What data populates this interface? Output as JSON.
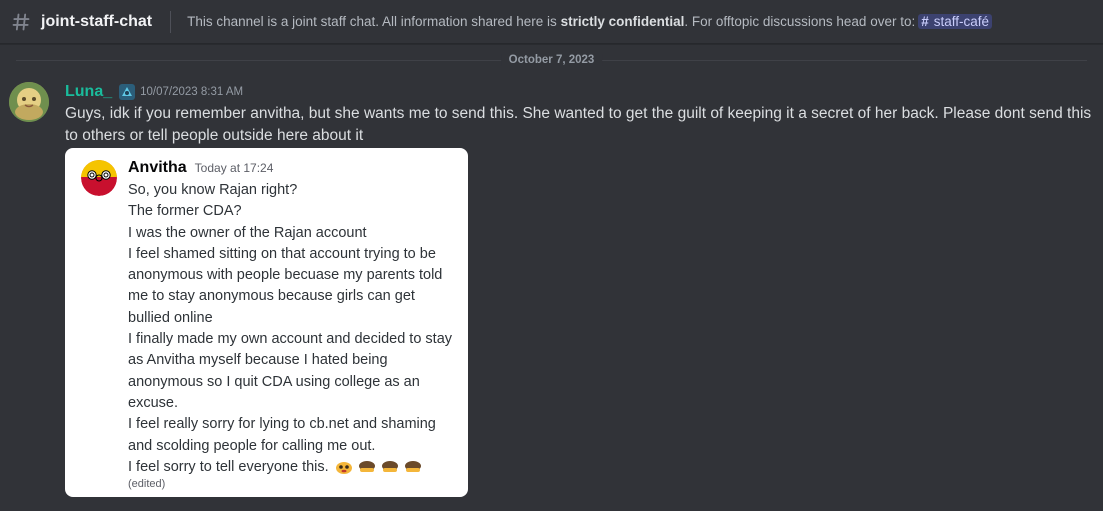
{
  "header": {
    "channel_name": "joint-staff-chat",
    "topic_pre": "This channel is a joint staff chat. All information shared here is ",
    "topic_bold": "strictly confidential",
    "topic_post": ". For offtopic discussions head over to:",
    "mention_channel": "staff-café"
  },
  "date_divider": "October 7, 2023",
  "message": {
    "author": "Luna_",
    "timestamp": "10/07/2023 8:31 AM",
    "text": "Guys, idk if you remember anvitha, but she wants me to send this. She wanted to get the guilt of keeping it a secret of her back. Please dont send this to others or tell people outside here about it"
  },
  "embed": {
    "author": "Anvitha",
    "timestamp": "Today at 17:24",
    "lines": [
      "So, you know Rajan right?",
      "The former CDA?",
      "I was the owner of the Rajan account",
      "I feel shamed sitting on that account trying to be",
      "anonymous with people becuase my parents told",
      "me to stay anonymous because girls can get",
      "bullied online",
      "I finally made my own account and decided to stay",
      "as Anvitha myself because I hated being",
      "anonymous so I quit CDA using college as an",
      "excuse.",
      "I feel really sorry for lying to cb.net and shaming",
      "and scolding people for calling me out.",
      "I feel sorry to tell everyone this."
    ],
    "edited_label": "(edited)",
    "emojis": [
      "pleading-face-emoji",
      "bowing-face-emoji",
      "bowing-face-emoji",
      "bowing-face-emoji"
    ]
  },
  "colors": {
    "background": "#313338",
    "username": "#1abc9c",
    "mention_bg": "#3c4270",
    "embed_bg": "#ffffff"
  }
}
